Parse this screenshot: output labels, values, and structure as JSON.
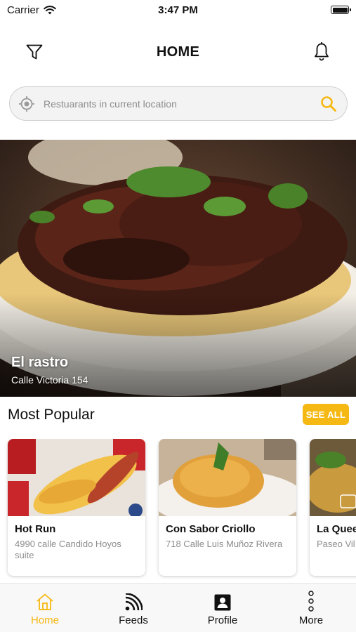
{
  "status_bar": {
    "carrier": "Carrier",
    "time": "3:47 PM"
  },
  "header": {
    "title": "HOME"
  },
  "search": {
    "placeholder": "Restuarants in current location"
  },
  "hero": {
    "name": "El rastro",
    "address": "Calle Victoria 154"
  },
  "popular": {
    "title": "Most Popular",
    "see_all_label": "SEE ALL",
    "cards": [
      {
        "name": "Hot Run",
        "address": "4990 calle Candido Hoyos suite"
      },
      {
        "name": "Con Sabor Criollo",
        "address": "718 Calle Luis Muñoz Rivera"
      },
      {
        "name": "La Quee",
        "address": "Paseo Vil Hibiscus"
      }
    ]
  },
  "tabs": [
    {
      "label": "Home",
      "icon": "home-icon",
      "active": true
    },
    {
      "label": "Feeds",
      "icon": "rss-feed-icon",
      "active": false
    },
    {
      "label": "Profile",
      "icon": "profile-card-icon",
      "active": false
    },
    {
      "label": "More",
      "icon": "vertical-dots-icon",
      "active": false
    }
  ],
  "colors": {
    "accent": "#f6b812",
    "text": "#111111",
    "muted": "#8d8d8d"
  }
}
